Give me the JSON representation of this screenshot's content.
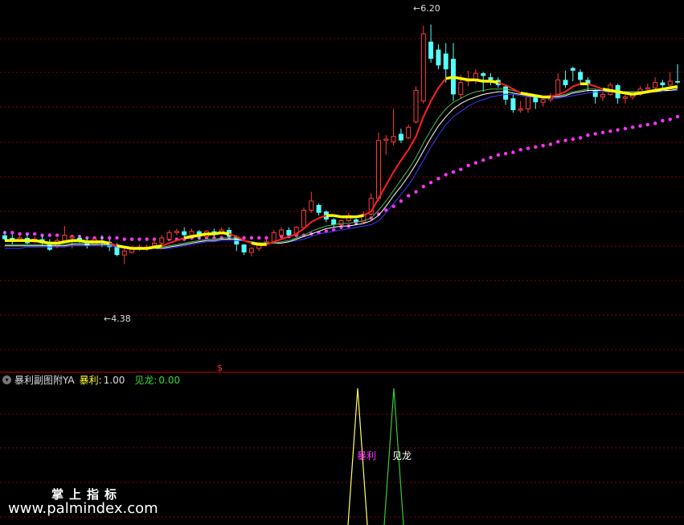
{
  "colors": {
    "up": "#ff3c3c",
    "down": "#54ffff",
    "grid": "#8b0000",
    "ma_red": "#ff2020",
    "ma_yellow": "#ffff00",
    "ma_white": "#ffffff",
    "ma_green": "#4ab84a",
    "ma_blue": "#3a3aff",
    "dots": "#ff33ff",
    "sig_baoli": "#ffff66",
    "sig_jianlong": "#33cc33"
  },
  "indicator": {
    "name": "暴利副图附YA",
    "baoli_label": "暴利:",
    "baoli_value": "1.00",
    "jianlong_label": "见龙:",
    "jianlong_value": "0.00"
  },
  "annotations": {
    "high": "6.20",
    "low": "4.38",
    "arrow": "←",
    "dollar": "$",
    "baoli_text": "暴利",
    "jianlong_text": "见龙"
  },
  "watermark": {
    "cn": "掌上指标",
    "url": "www.palmindex.com"
  },
  "chart_data": [
    {
      "type": "candlestick",
      "ylim": [
        3.7,
        6.35
      ],
      "candles": [
        [
          4.6,
          4.57,
          4.63,
          4.56
        ],
        [
          4.58,
          4.55,
          4.61,
          4.53
        ],
        [
          4.56,
          4.58,
          4.6,
          4.55
        ],
        [
          4.58,
          4.54,
          4.61,
          4.53
        ],
        [
          4.55,
          4.57,
          4.59,
          4.54
        ],
        [
          4.57,
          4.54,
          4.6,
          4.52
        ],
        [
          4.55,
          4.49,
          4.57,
          4.48
        ],
        [
          4.52,
          4.56,
          4.58,
          4.5
        ],
        [
          4.56,
          4.6,
          4.67,
          4.55
        ],
        [
          4.58,
          4.59,
          4.6,
          4.5
        ],
        [
          4.58,
          4.56,
          4.6,
          4.54
        ],
        [
          4.56,
          4.52,
          4.58,
          4.5
        ],
        [
          4.53,
          4.57,
          4.59,
          4.52
        ],
        [
          4.56,
          4.55,
          4.6,
          4.51
        ],
        [
          4.55,
          4.51,
          4.57,
          4.48
        ],
        [
          4.52,
          4.45,
          4.54,
          4.44
        ],
        [
          4.45,
          4.48,
          4.5,
          4.38
        ],
        [
          4.47,
          4.5,
          4.52,
          4.46
        ],
        [
          4.5,
          4.51,
          4.53,
          4.48
        ],
        [
          4.51,
          4.51,
          4.53,
          4.48
        ],
        [
          4.52,
          4.54,
          4.58,
          4.52
        ],
        [
          4.54,
          4.58,
          4.6,
          4.53
        ],
        [
          4.57,
          4.62,
          4.64,
          4.56
        ],
        [
          4.62,
          4.63,
          4.65,
          4.6
        ],
        [
          4.63,
          4.6,
          4.66,
          4.58
        ],
        [
          4.6,
          4.63,
          4.65,
          4.58
        ],
        [
          4.63,
          4.59,
          4.64,
          4.57
        ],
        [
          4.59,
          4.63,
          4.64,
          4.58
        ],
        [
          4.63,
          4.61,
          4.65,
          4.59
        ],
        [
          4.61,
          4.64,
          4.66,
          4.6
        ],
        [
          4.64,
          4.59,
          4.66,
          4.57
        ],
        [
          4.59,
          4.53,
          4.6,
          4.48
        ],
        [
          4.53,
          4.47,
          4.53,
          4.45
        ],
        [
          4.47,
          4.5,
          4.51,
          4.44
        ],
        [
          4.5,
          4.54,
          4.55,
          4.48
        ],
        [
          4.54,
          4.55,
          4.57,
          4.52
        ],
        [
          4.55,
          4.62,
          4.64,
          4.54
        ],
        [
          4.6,
          4.64,
          4.66,
          4.57
        ],
        [
          4.64,
          4.6,
          4.66,
          4.59
        ],
        [
          4.61,
          4.66,
          4.67,
          4.59
        ],
        [
          4.66,
          4.79,
          4.81,
          4.65
        ],
        [
          4.79,
          4.86,
          4.93,
          4.77
        ],
        [
          4.83,
          4.77,
          4.84,
          4.75
        ],
        [
          4.78,
          4.72,
          4.79,
          4.7
        ],
        [
          4.72,
          4.68,
          4.73,
          4.66
        ],
        [
          4.68,
          4.71,
          4.72,
          4.67
        ],
        [
          4.71,
          4.75,
          4.77,
          4.7
        ],
        [
          4.72,
          4.7,
          4.73,
          4.68
        ],
        [
          4.7,
          4.76,
          4.78,
          4.69
        ],
        [
          4.76,
          4.88,
          4.92,
          4.75
        ],
        [
          4.88,
          5.32,
          5.38,
          4.86
        ],
        [
          5.32,
          5.33,
          5.36,
          5.21
        ],
        [
          5.31,
          5.35,
          5.56,
          5.28
        ],
        [
          5.37,
          5.32,
          5.41,
          5.3
        ],
        [
          5.34,
          5.42,
          5.44,
          5.33
        ],
        [
          5.46,
          5.7,
          5.73,
          5.45
        ],
        [
          5.62,
          6.13,
          6.19,
          5.6
        ],
        [
          6.07,
          5.94,
          6.2,
          5.91
        ],
        [
          6.01,
          5.89,
          6.05,
          5.86
        ],
        [
          5.98,
          5.86,
          6.06,
          5.76
        ],
        [
          5.94,
          5.67,
          6.06,
          5.62
        ],
        [
          5.67,
          5.76,
          5.82,
          5.64
        ],
        [
          5.77,
          5.78,
          5.85,
          5.73
        ],
        [
          5.78,
          5.83,
          5.86,
          5.75
        ],
        [
          5.83,
          5.81,
          5.84,
          5.69
        ],
        [
          5.8,
          5.78,
          5.83,
          5.74
        ],
        [
          5.78,
          5.74,
          5.8,
          5.72
        ],
        [
          5.73,
          5.63,
          5.74,
          5.59
        ],
        [
          5.64,
          5.55,
          5.67,
          5.53
        ],
        [
          5.55,
          5.56,
          5.62,
          5.53
        ],
        [
          5.56,
          5.65,
          5.67,
          5.53
        ],
        [
          5.65,
          5.61,
          5.66,
          5.56
        ],
        [
          5.61,
          5.63,
          5.66,
          5.58
        ],
        [
          5.63,
          5.66,
          5.68,
          5.61
        ],
        [
          5.66,
          5.78,
          5.83,
          5.65
        ],
        [
          5.78,
          5.74,
          5.85,
          5.72
        ],
        [
          5.87,
          5.85,
          5.88,
          5.77
        ],
        [
          5.84,
          5.78,
          5.86,
          5.74
        ],
        [
          5.78,
          5.74,
          5.8,
          5.69
        ],
        [
          5.7,
          5.65,
          5.71,
          5.6
        ],
        [
          5.65,
          5.67,
          5.69,
          5.62
        ],
        [
          5.67,
          5.74,
          5.76,
          5.66
        ],
        [
          5.74,
          5.64,
          5.75,
          5.6
        ],
        [
          5.64,
          5.65,
          5.67,
          5.6
        ],
        [
          5.65,
          5.67,
          5.69,
          5.63
        ],
        [
          5.67,
          5.71,
          5.73,
          5.66
        ],
        [
          5.71,
          5.72,
          5.75,
          5.69
        ],
        [
          5.72,
          5.76,
          5.8,
          5.71
        ],
        [
          5.76,
          5.74,
          5.78,
          5.72
        ],
        [
          5.74,
          5.77,
          5.84,
          5.73
        ],
        [
          5.77,
          5.76,
          5.9,
          5.75
        ]
      ],
      "ma_lines": [
        {
          "color_key": "ma_red",
          "values": [
            4.56,
            4.56,
            4.56,
            4.56,
            4.56,
            4.55,
            4.54,
            4.54,
            4.55,
            4.56,
            4.56,
            4.55,
            4.55,
            4.55,
            4.54,
            4.52,
            4.51,
            4.5,
            4.5,
            4.5,
            4.51,
            4.52,
            4.54,
            4.56,
            4.58,
            4.59,
            4.6,
            4.61,
            4.61,
            4.62,
            4.61,
            4.59,
            4.56,
            4.54,
            4.53,
            4.53,
            4.55,
            4.57,
            4.59,
            4.61,
            4.65,
            4.7,
            4.73,
            4.75,
            4.75,
            4.74,
            4.74,
            4.74,
            4.75,
            4.78,
            4.88,
            4.98,
            5.08,
            5.17,
            5.25,
            5.35,
            5.5,
            5.62,
            5.72,
            5.79,
            5.8,
            5.79,
            5.78,
            5.78,
            5.77,
            5.77,
            5.76,
            5.74,
            5.71,
            5.68,
            5.67,
            5.66,
            5.65,
            5.65,
            5.67,
            5.69,
            5.73,
            5.75,
            5.75,
            5.73,
            5.71,
            5.7,
            5.69,
            5.68,
            5.67,
            5.68,
            5.69,
            5.7,
            5.71,
            5.72,
            5.73
          ]
        },
        {
          "color_key": "ma_green",
          "values": [
            4.53,
            4.53,
            4.53,
            4.53,
            4.53,
            4.53,
            4.53,
            4.53,
            4.53,
            4.54,
            4.54,
            4.54,
            4.54,
            4.54,
            4.53,
            4.52,
            4.51,
            4.5,
            4.5,
            4.5,
            4.5,
            4.51,
            4.52,
            4.53,
            4.54,
            4.55,
            4.56,
            4.57,
            4.57,
            4.58,
            4.58,
            4.58,
            4.56,
            4.55,
            4.54,
            4.54,
            4.54,
            4.55,
            4.56,
            4.58,
            4.6,
            4.63,
            4.65,
            4.67,
            4.68,
            4.69,
            4.69,
            4.7,
            4.71,
            4.73,
            4.79,
            4.86,
            4.94,
            5.02,
            5.1,
            5.19,
            5.3,
            5.4,
            5.49,
            5.56,
            5.61,
            5.64,
            5.67,
            5.69,
            5.7,
            5.71,
            5.71,
            5.71,
            5.7,
            5.68,
            5.67,
            5.66,
            5.65,
            5.65,
            5.66,
            5.67,
            5.69,
            5.7,
            5.71,
            5.71,
            5.7,
            5.7,
            5.69,
            5.69,
            5.69,
            5.69,
            5.69,
            5.7,
            5.7,
            5.71,
            5.72
          ]
        },
        {
          "color_key": "ma_white",
          "values": [
            4.52,
            4.52,
            4.52,
            4.52,
            4.52,
            4.52,
            4.52,
            4.52,
            4.52,
            4.53,
            4.53,
            4.53,
            4.53,
            4.53,
            4.53,
            4.52,
            4.51,
            4.5,
            4.5,
            4.5,
            4.5,
            4.5,
            4.51,
            4.52,
            4.53,
            4.54,
            4.55,
            4.56,
            4.56,
            4.57,
            4.57,
            4.57,
            4.56,
            4.55,
            4.54,
            4.54,
            4.54,
            4.54,
            4.55,
            4.57,
            4.59,
            4.61,
            4.63,
            4.65,
            4.66,
            4.67,
            4.67,
            4.68,
            4.69,
            4.71,
            4.75,
            4.82,
            4.9,
            4.97,
            5.05,
            5.14,
            5.24,
            5.34,
            5.43,
            5.5,
            5.56,
            5.6,
            5.63,
            5.65,
            5.67,
            5.68,
            5.69,
            5.69,
            5.68,
            5.67,
            5.66,
            5.65,
            5.65,
            5.65,
            5.65,
            5.66,
            5.68,
            5.69,
            5.7,
            5.7,
            5.7,
            5.69,
            5.69,
            5.69,
            5.69,
            5.69,
            5.69,
            5.69,
            5.7,
            5.7,
            5.71
          ]
        },
        {
          "color_key": "ma_blue",
          "values": [
            4.5,
            4.5,
            4.5,
            4.51,
            4.51,
            4.51,
            4.51,
            4.51,
            4.51,
            4.52,
            4.52,
            4.52,
            4.52,
            4.52,
            4.52,
            4.51,
            4.5,
            4.5,
            4.5,
            4.5,
            4.5,
            4.5,
            4.5,
            4.51,
            4.52,
            4.53,
            4.54,
            4.55,
            4.55,
            4.56,
            4.56,
            4.56,
            4.56,
            4.55,
            4.54,
            4.54,
            4.54,
            4.54,
            4.55,
            4.56,
            4.57,
            4.59,
            4.61,
            4.62,
            4.63,
            4.64,
            4.65,
            4.66,
            4.67,
            4.68,
            4.71,
            4.77,
            4.84,
            4.91,
            4.98,
            5.07,
            5.17,
            5.27,
            5.36,
            5.44,
            5.5,
            5.54,
            5.58,
            5.61,
            5.63,
            5.65,
            5.66,
            5.67,
            5.67,
            5.66,
            5.65,
            5.65,
            5.64,
            5.64,
            5.64,
            5.65,
            5.66,
            5.67,
            5.68,
            5.69,
            5.69,
            5.69,
            5.69,
            5.69,
            5.69,
            5.68,
            5.68,
            5.69,
            5.69,
            5.7,
            5.7
          ]
        }
      ],
      "dots": [
        4.62,
        4.62,
        4.61,
        4.61,
        4.61,
        4.6,
        4.6,
        4.6,
        4.59,
        4.59,
        4.59,
        4.58,
        4.58,
        4.58,
        4.58,
        4.58,
        4.57,
        4.57,
        4.57,
        4.57,
        4.57,
        4.57,
        4.57,
        4.57,
        4.57,
        4.58,
        4.58,
        4.58,
        4.58,
        4.58,
        4.58,
        4.58,
        4.58,
        4.58,
        4.58,
        4.58,
        4.58,
        4.59,
        4.59,
        4.6,
        4.6,
        4.61,
        4.62,
        4.63,
        4.64,
        4.66,
        4.67,
        4.69,
        4.71,
        4.73,
        4.76,
        4.79,
        4.82,
        4.86,
        4.9,
        4.93,
        4.97,
        5.0,
        5.03,
        5.06,
        5.08,
        5.1,
        5.13,
        5.15,
        5.17,
        5.19,
        5.21,
        5.22,
        5.23,
        5.25,
        5.26,
        5.27,
        5.28,
        5.29,
        5.31,
        5.32,
        5.33,
        5.34,
        5.36,
        5.37,
        5.38,
        5.39,
        5.4,
        5.41,
        5.42,
        5.43,
        5.44,
        5.45,
        5.47,
        5.48,
        5.5
      ]
    },
    {
      "type": "line",
      "series": [
        {
          "name": "暴利",
          "color_key": "sig_baoli",
          "values": [
            [
              0,
              0
            ],
            [
              1,
              1
            ],
            [
              2,
              0
            ]
          ]
        },
        {
          "name": "见龙",
          "color_key": "sig_jianlong",
          "values": [
            [
              0,
              0
            ],
            [
              1,
              1
            ],
            [
              2,
              0
            ]
          ]
        }
      ],
      "ylim": [
        0,
        1
      ]
    }
  ]
}
